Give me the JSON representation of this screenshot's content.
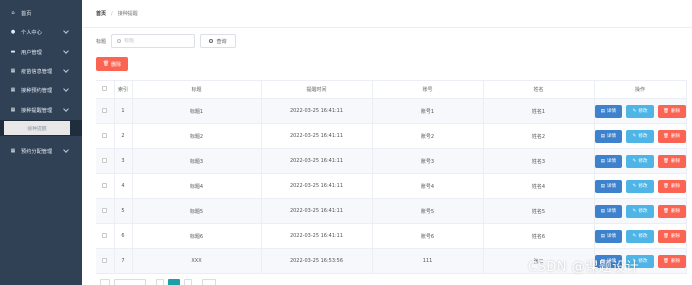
{
  "sidebar": {
    "items": [
      {
        "label": "首页",
        "icon": "home-icon",
        "chevron": false
      },
      {
        "label": "个人中心",
        "icon": "user-icon",
        "chevron": true
      },
      {
        "label": "用户管理",
        "icon": "users-icon",
        "chevron": true
      },
      {
        "label": "疫苗信息管理",
        "icon": "grid-icon",
        "chevron": true
      },
      {
        "label": "接种预约管理",
        "icon": "grid-icon",
        "chevron": true
      },
      {
        "label": "接种提醒管理",
        "icon": "grid-icon",
        "chevron": true
      },
      {
        "label": "预约分配管理",
        "icon": "grid-icon",
        "chevron": true
      }
    ],
    "active_sub": "接种提醒"
  },
  "breadcrumb": {
    "home": "首页",
    "sep": "/",
    "current": "接种提醒"
  },
  "search": {
    "label": "标题",
    "placeholder": "标题",
    "query_label": "查询"
  },
  "toolbar": {
    "delete_label": "删除"
  },
  "table": {
    "headers": [
      "索引",
      "标题",
      "提醒时间",
      "账号",
      "姓名",
      "操作"
    ],
    "rows": [
      [
        "1",
        "标题1",
        "2022-03-25 16:41:11",
        "账号1",
        "姓名1"
      ],
      [
        "2",
        "标题2",
        "2022-03-25 16:41:11",
        "账号2",
        "姓名2"
      ],
      [
        "3",
        "标题3",
        "2022-03-25 16:41:11",
        "账号3",
        "姓名3"
      ],
      [
        "4",
        "标题4",
        "2022-03-25 16:41:11",
        "账号4",
        "姓名4"
      ],
      [
        "5",
        "标题5",
        "2022-03-25 16:41:11",
        "账号5",
        "姓名5"
      ],
      [
        "6",
        "标题6",
        "2022-03-25 16:41:11",
        "账号6",
        "姓名6"
      ],
      [
        "7",
        "XXX",
        "2022-03-25 16:53:56",
        "111",
        "张三"
      ]
    ],
    "actions": {
      "detail": "详情",
      "edit": "修改",
      "delete": "删除"
    }
  },
  "watermark": "CSDN @课题设计",
  "colors": {
    "sidebar": "#304156",
    "danger": "#fb6352",
    "primary": "#3e82ce",
    "info": "#4fb5e6",
    "accent": "#1aa1a8"
  }
}
